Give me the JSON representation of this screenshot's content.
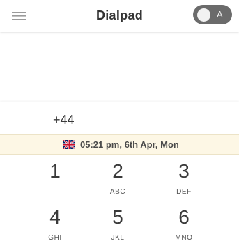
{
  "header": {
    "title": "Dialpad",
    "toggle_label": "A"
  },
  "dial": {
    "number": "+44"
  },
  "timezone": {
    "flag": "uk-flag-icon",
    "time_text": "05:21 pm, 6th Apr, Mon"
  },
  "keypad": {
    "keys": [
      {
        "digit": "1",
        "letters": ""
      },
      {
        "digit": "2",
        "letters": "ABC"
      },
      {
        "digit": "3",
        "letters": "DEF"
      },
      {
        "digit": "4",
        "letters": "GHI"
      },
      {
        "digit": "5",
        "letters": "JKL"
      },
      {
        "digit": "6",
        "letters": "MNO"
      }
    ]
  }
}
